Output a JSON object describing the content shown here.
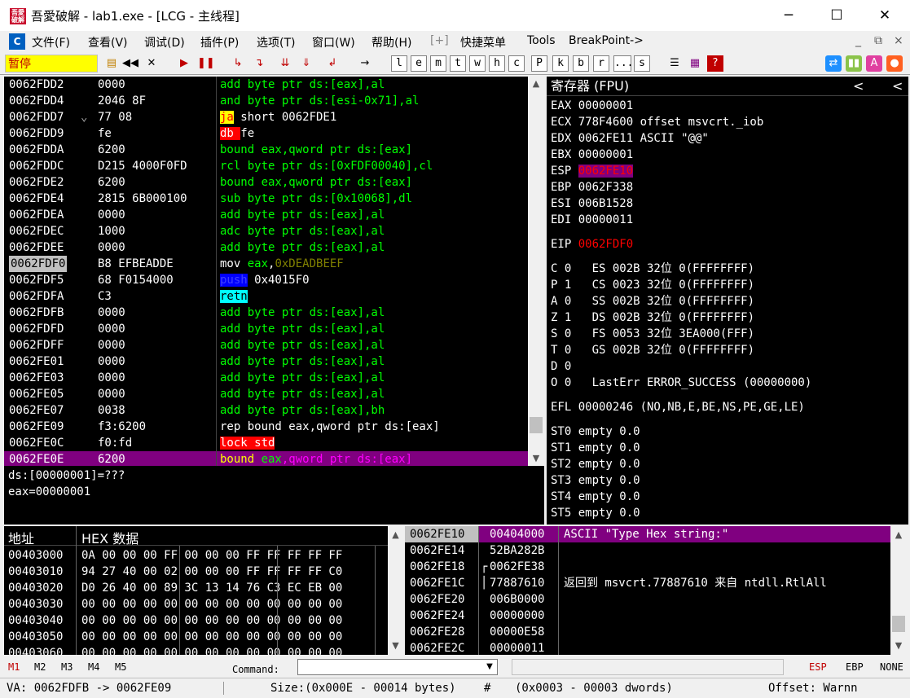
{
  "window": {
    "title": "吾愛破解 - lab1.exe - [LCG - 主线程]",
    "minimize": "─",
    "maximize": "☐",
    "close": "✕",
    "icon_text": "吾愛破解"
  },
  "menu": {
    "items": [
      "文件(F)",
      "查看(V)",
      "调试(D)",
      "插件(P)",
      "选项(T)",
      "窗口(W)",
      "帮助(H)",
      "[+]",
      "快捷菜单",
      "Tools",
      "BreakPoint->"
    ],
    "right": [
      "_",
      "⧉",
      "×"
    ]
  },
  "toolbar": {
    "status": "暂停",
    "letters": [
      "l",
      "e",
      "m",
      "t",
      "w",
      "h",
      "c",
      "P",
      "k",
      "b",
      "r",
      "...",
      "s"
    ]
  },
  "disasm": {
    "rows": [
      {
        "addr": "0062FDD2",
        "hex": "0000",
        "ins": [
          {
            "t": "add byte ptr ds:[eax],al",
            "c": "#00ff00"
          }
        ]
      },
      {
        "addr": "0062FDD4",
        "hex": "2046 8F",
        "ins": [
          {
            "t": "and byte ptr ds:[esi-0x71],al",
            "c": "#00ff00"
          }
        ]
      },
      {
        "addr": "0062FDD7",
        "mark": "⌄",
        "hex": "77 08",
        "ins": [
          {
            "t": "ja",
            "c": "#ff0000",
            "bg": "#ffff00"
          },
          {
            "t": " short 0062FDE1",
            "c": "#ffffff"
          }
        ]
      },
      {
        "addr": "0062FDD9",
        "hex": "fe",
        "ins": [
          {
            "t": "db ",
            "c": "#ffffff",
            "bg": "#ff0000"
          },
          {
            "t": "fe",
            "c": "#ffffff"
          }
        ]
      },
      {
        "addr": "0062FDDA",
        "hex": "6200",
        "ins": [
          {
            "t": "bound eax,qword ptr ds:[eax]",
            "c": "#00ff00"
          }
        ]
      },
      {
        "addr": "0062FDDC",
        "hex": "D215 4000F0FD",
        "ins": [
          {
            "t": "rcl byte ptr ds:[0xFDF00040],cl",
            "c": "#00ff00"
          }
        ]
      },
      {
        "addr": "0062FDE2",
        "hex": "6200",
        "ins": [
          {
            "t": "bound eax,qword ptr ds:[eax]",
            "c": "#00ff00"
          }
        ]
      },
      {
        "addr": "0062FDE4",
        "hex": "2815 6B000100",
        "ins": [
          {
            "t": "sub byte ptr ds:[0x10068],dl",
            "c": "#00ff00"
          }
        ]
      },
      {
        "addr": "0062FDEA",
        "hex": "0000",
        "ins": [
          {
            "t": "add byte ptr ds:[eax],al",
            "c": "#00ff00"
          }
        ]
      },
      {
        "addr": "0062FDEC",
        "hex": "1000",
        "ins": [
          {
            "t": "adc byte ptr ds:[eax],al",
            "c": "#00ff00"
          }
        ]
      },
      {
        "addr": "0062FDEE",
        "hex": "0000",
        "ins": [
          {
            "t": "add byte ptr ds:[eax],al",
            "c": "#00ff00"
          }
        ]
      },
      {
        "addr": "0062FDF0",
        "sel": true,
        "hex": "B8 EFBEADDE",
        "ins": [
          {
            "t": "mov ",
            "c": "#ffffff"
          },
          {
            "t": "eax",
            "c": "#00ff00"
          },
          {
            "t": ",",
            "c": "#ffffff"
          },
          {
            "t": "0xDEADBEEF",
            "c": "#808000"
          }
        ]
      },
      {
        "addr": "0062FDF5",
        "hex": "68 F0154000",
        "ins": [
          {
            "t": "push",
            "c": "#4040ff",
            "bg": "#0000ff"
          },
          {
            "t": " 0x4015F0",
            "c": "#ffffff"
          }
        ]
      },
      {
        "addr": "0062FDFA",
        "hex": "C3",
        "ins": [
          {
            "t": "retn",
            "c": "#000000",
            "bg": "#00ffff"
          }
        ]
      },
      {
        "addr": "0062FDFB",
        "hex": "0000",
        "ins": [
          {
            "t": "add byte ptr ds:[eax],al",
            "c": "#00ff00"
          }
        ]
      },
      {
        "addr": "0062FDFD",
        "hex": "0000",
        "ins": [
          {
            "t": "add byte ptr ds:[eax],al",
            "c": "#00ff00"
          }
        ]
      },
      {
        "addr": "0062FDFF",
        "hex": "0000",
        "ins": [
          {
            "t": "add byte ptr ds:[eax],al",
            "c": "#00ff00"
          }
        ]
      },
      {
        "addr": "0062FE01",
        "hex": "0000",
        "ins": [
          {
            "t": "add byte ptr ds:[eax],al",
            "c": "#00ff00"
          }
        ]
      },
      {
        "addr": "0062FE03",
        "hex": "0000",
        "ins": [
          {
            "t": "add byte ptr ds:[eax],al",
            "c": "#00ff00"
          }
        ]
      },
      {
        "addr": "0062FE05",
        "hex": "0000",
        "ins": [
          {
            "t": "add byte ptr ds:[eax],al",
            "c": "#00ff00"
          }
        ]
      },
      {
        "addr": "0062FE07",
        "hex": "0038",
        "ins": [
          {
            "t": "add byte ptr ds:[eax],bh",
            "c": "#00ff00"
          }
        ]
      },
      {
        "addr": "0062FE09",
        "hex": "f3:6200",
        "ins": [
          {
            "t": "rep bound eax,qword ptr ds:[eax]",
            "c": "#ffffff"
          }
        ]
      },
      {
        "addr": "0062FE0C",
        "hex": "f0:fd",
        "ins": [
          {
            "t": "lock std",
            "c": "#ffffff",
            "bg": "#ff0000"
          }
        ]
      },
      {
        "addr": "0062FE0E",
        "hl": true,
        "hex": "6200",
        "ins": [
          {
            "t": "bound ",
            "c": "#ffff00"
          },
          {
            "t": "eax",
            "c": "#00ff00"
          },
          {
            "t": ",qword ptr ds:[eax]",
            "c": "#ff00ff"
          }
        ]
      }
    ]
  },
  "info": {
    "lines": [
      "ds:[00000001]=???",
      "eax=00000001"
    ]
  },
  "registers": {
    "header": "寄存器 (FPU)",
    "nav": [
      "<",
      "<"
    ],
    "lines": [
      [
        {
          "t": "EAX 00000001",
          "c": "#ffffff"
        }
      ],
      [
        {
          "t": "ECX 778F4600 offset msvcrt._iob",
          "c": "#ffffff"
        }
      ],
      [
        {
          "t": "EDX 0062FE11 ASCII \"@@\"",
          "c": "#ffffff"
        }
      ],
      [
        {
          "t": "EBX 00000001",
          "c": "#ffffff"
        }
      ],
      [
        {
          "t": "ESP ",
          "c": "#ffffff"
        },
        {
          "t": "0062FE10",
          "c": "#ff0000",
          "bg": "#800080"
        }
      ],
      [
        {
          "t": "EBP 0062F338",
          "c": "#ffffff"
        }
      ],
      [
        {
          "t": "ESI 006B1528",
          "c": "#ffffff"
        }
      ],
      [
        {
          "t": "EDI 00000011",
          "c": "#ffffff"
        }
      ],
      [
        {
          "t": "",
          "c": "#ffffff",
          "gap": true
        }
      ],
      [
        {
          "t": "EIP ",
          "c": "#ffffff"
        },
        {
          "t": "0062FDF0",
          "c": "#ff0000"
        }
      ],
      [
        {
          "t": "",
          "c": "#ffffff",
          "gap": true
        }
      ],
      [
        {
          "t": "C 0   ES 002B 32位 0(FFFFFFFF)",
          "c": "#ffffff"
        }
      ],
      [
        {
          "t": "P 1   CS 0023 32位 0(FFFFFFFF)",
          "c": "#ffffff"
        }
      ],
      [
        {
          "t": "A 0   SS 002B 32位 0(FFFFFFFF)",
          "c": "#ffffff"
        }
      ],
      [
        {
          "t": "Z 1   DS 002B 32位 0(FFFFFFFF)",
          "c": "#ffffff"
        }
      ],
      [
        {
          "t": "S 0   FS 0053 32位 3EA000(FFF)",
          "c": "#ffffff"
        }
      ],
      [
        {
          "t": "T 0   GS 002B 32位 0(FFFFFFFF)",
          "c": "#ffffff"
        }
      ],
      [
        {
          "t": "D 0",
          "c": "#ffffff"
        }
      ],
      [
        {
          "t": "O 0   LastErr ERROR_SUCCESS (00000000)",
          "c": "#ffffff"
        }
      ],
      [
        {
          "t": "",
          "c": "#ffffff",
          "gap": true
        }
      ],
      [
        {
          "t": "EFL 00000246 (NO,NB,E,BE,NS,PE,GE,LE)",
          "c": "#ffffff"
        }
      ],
      [
        {
          "t": "",
          "c": "#ffffff",
          "gap": true
        }
      ],
      [
        {
          "t": "ST0 empty 0.0",
          "c": "#ffffff"
        }
      ],
      [
        {
          "t": "ST1 empty 0.0",
          "c": "#ffffff"
        }
      ],
      [
        {
          "t": "ST2 empty 0.0",
          "c": "#ffffff"
        }
      ],
      [
        {
          "t": "ST3 empty 0.0",
          "c": "#ffffff"
        }
      ],
      [
        {
          "t": "ST4 empty 0.0",
          "c": "#ffffff"
        }
      ],
      [
        {
          "t": "ST5 empty 0.0",
          "c": "#ffffff"
        }
      ]
    ]
  },
  "dump": {
    "col_addr": "地址",
    "col_hex": "HEX 数据",
    "rows": [
      {
        "addr": "00403000",
        "hex": "0A 00 00 00 FF 00 00 00 FF FF FF FF FF"
      },
      {
        "addr": "00403010",
        "hex": "94 27 40 00 02 00 00 00 FF FF FF FF C0"
      },
      {
        "addr": "00403020",
        "hex": "D0 26 40 00 89 3C 13 14 76 C3 EC EB 00"
      },
      {
        "addr": "00403030",
        "hex": "00 00 00 00 00 00 00 00 00 00 00 00 00"
      },
      {
        "addr": "00403040",
        "hex": "00 00 00 00 00 00 00 00 00 00 00 00 00"
      },
      {
        "addr": "00403050",
        "hex": "00 00 00 00 00 00 00 00 00 00 00 00 00"
      },
      {
        "addr": "00403060",
        "hex": "00 00 00 00 00 00 00 00 00 00 00 00 00"
      }
    ]
  },
  "stack": {
    "rows": [
      {
        "addr": "0062FE10",
        "val": "00404000",
        "cmt": "ASCII \"Type Hex string:\"",
        "sel": true
      },
      {
        "addr": "0062FE14",
        "val": "52BA282B",
        "cmt": ""
      },
      {
        "addr": "0062FE18",
        "val": "0062FE38",
        "cmt": "",
        "bracket": "┌"
      },
      {
        "addr": "0062FE1C",
        "val": "77887610",
        "cmt": "返回到 msvcrt.77887610 来自 ntdll.RtlAll",
        "bracket": "│"
      },
      {
        "addr": "0062FE20",
        "val": "006B0000",
        "cmt": ""
      },
      {
        "addr": "0062FE24",
        "val": "00000000",
        "cmt": ""
      },
      {
        "addr": "0062FE28",
        "val": "00000E58",
        "cmt": ""
      },
      {
        "addr": "0062FE2C",
        "val": "00000011",
        "cmt": ""
      }
    ]
  },
  "cmdbar": {
    "marks": [
      "M1",
      "M2",
      "M3",
      "M4",
      "M5"
    ],
    "label": "Command:",
    "value": "",
    "right": [
      "ESP",
      "EBP",
      "NONE"
    ]
  },
  "status": {
    "va": "VA: 0062FDFB -> 0062FE09",
    "size": "Size:(0x000E - 00014 bytes)",
    "hash": "#",
    "dwords": "(0x0003 - 00003 dwords)",
    "offset": "Offset: Warnn"
  }
}
